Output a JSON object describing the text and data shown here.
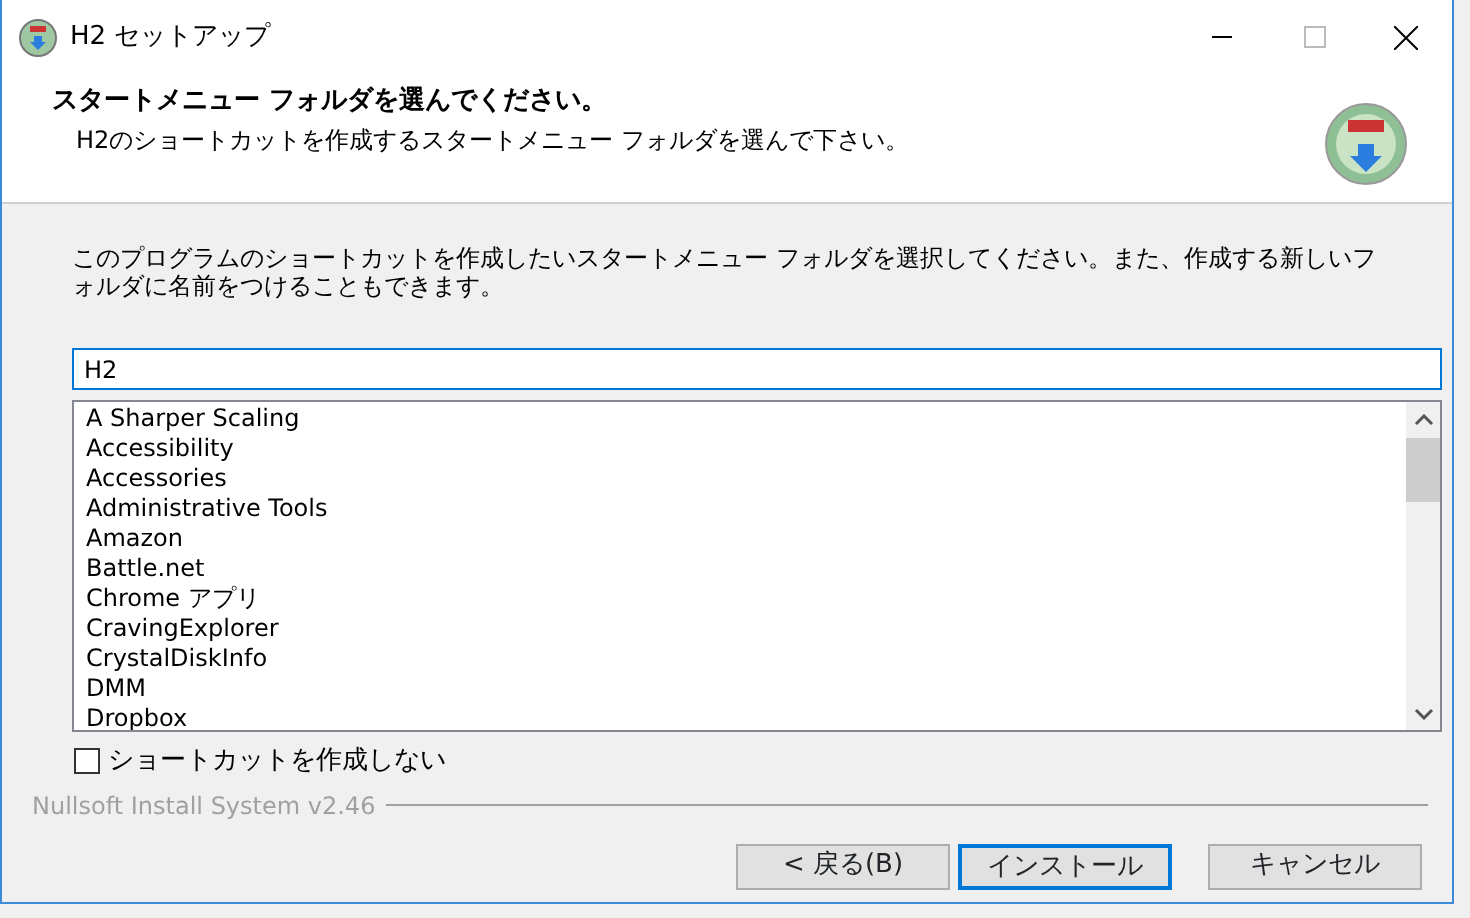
{
  "window": {
    "title": "H2 セットアップ"
  },
  "header": {
    "title": "スタートメニュー フォルダを選んでください。",
    "subtitle": "H2のショートカットを作成するスタートメニュー フォルダを選んで下さい。"
  },
  "intro": "このプログラムのショートカットを作成したいスタートメニュー フォルダを選択してください。また、作成する新しいフォルダに名前をつけることもできます。",
  "folder_field": {
    "value": "H2"
  },
  "folder_list": [
    "A Sharper Scaling",
    "Accessibility",
    "Accessories",
    "Administrative Tools",
    "Amazon",
    "Battle.net",
    "Chrome アプリ",
    "CravingExplorer",
    "CrystalDiskInfo",
    "DMM",
    "Dropbox"
  ],
  "no_shortcut": {
    "label": "ショートカットを作成しない",
    "checked": false
  },
  "branding": "Nullsoft Install System v2.46",
  "buttons": [
    {
      "label": "< 戻る(B)",
      "default": false
    },
    {
      "label": "インストール",
      "default": true
    },
    {
      "label": "キャンセル",
      "default": false
    }
  ]
}
